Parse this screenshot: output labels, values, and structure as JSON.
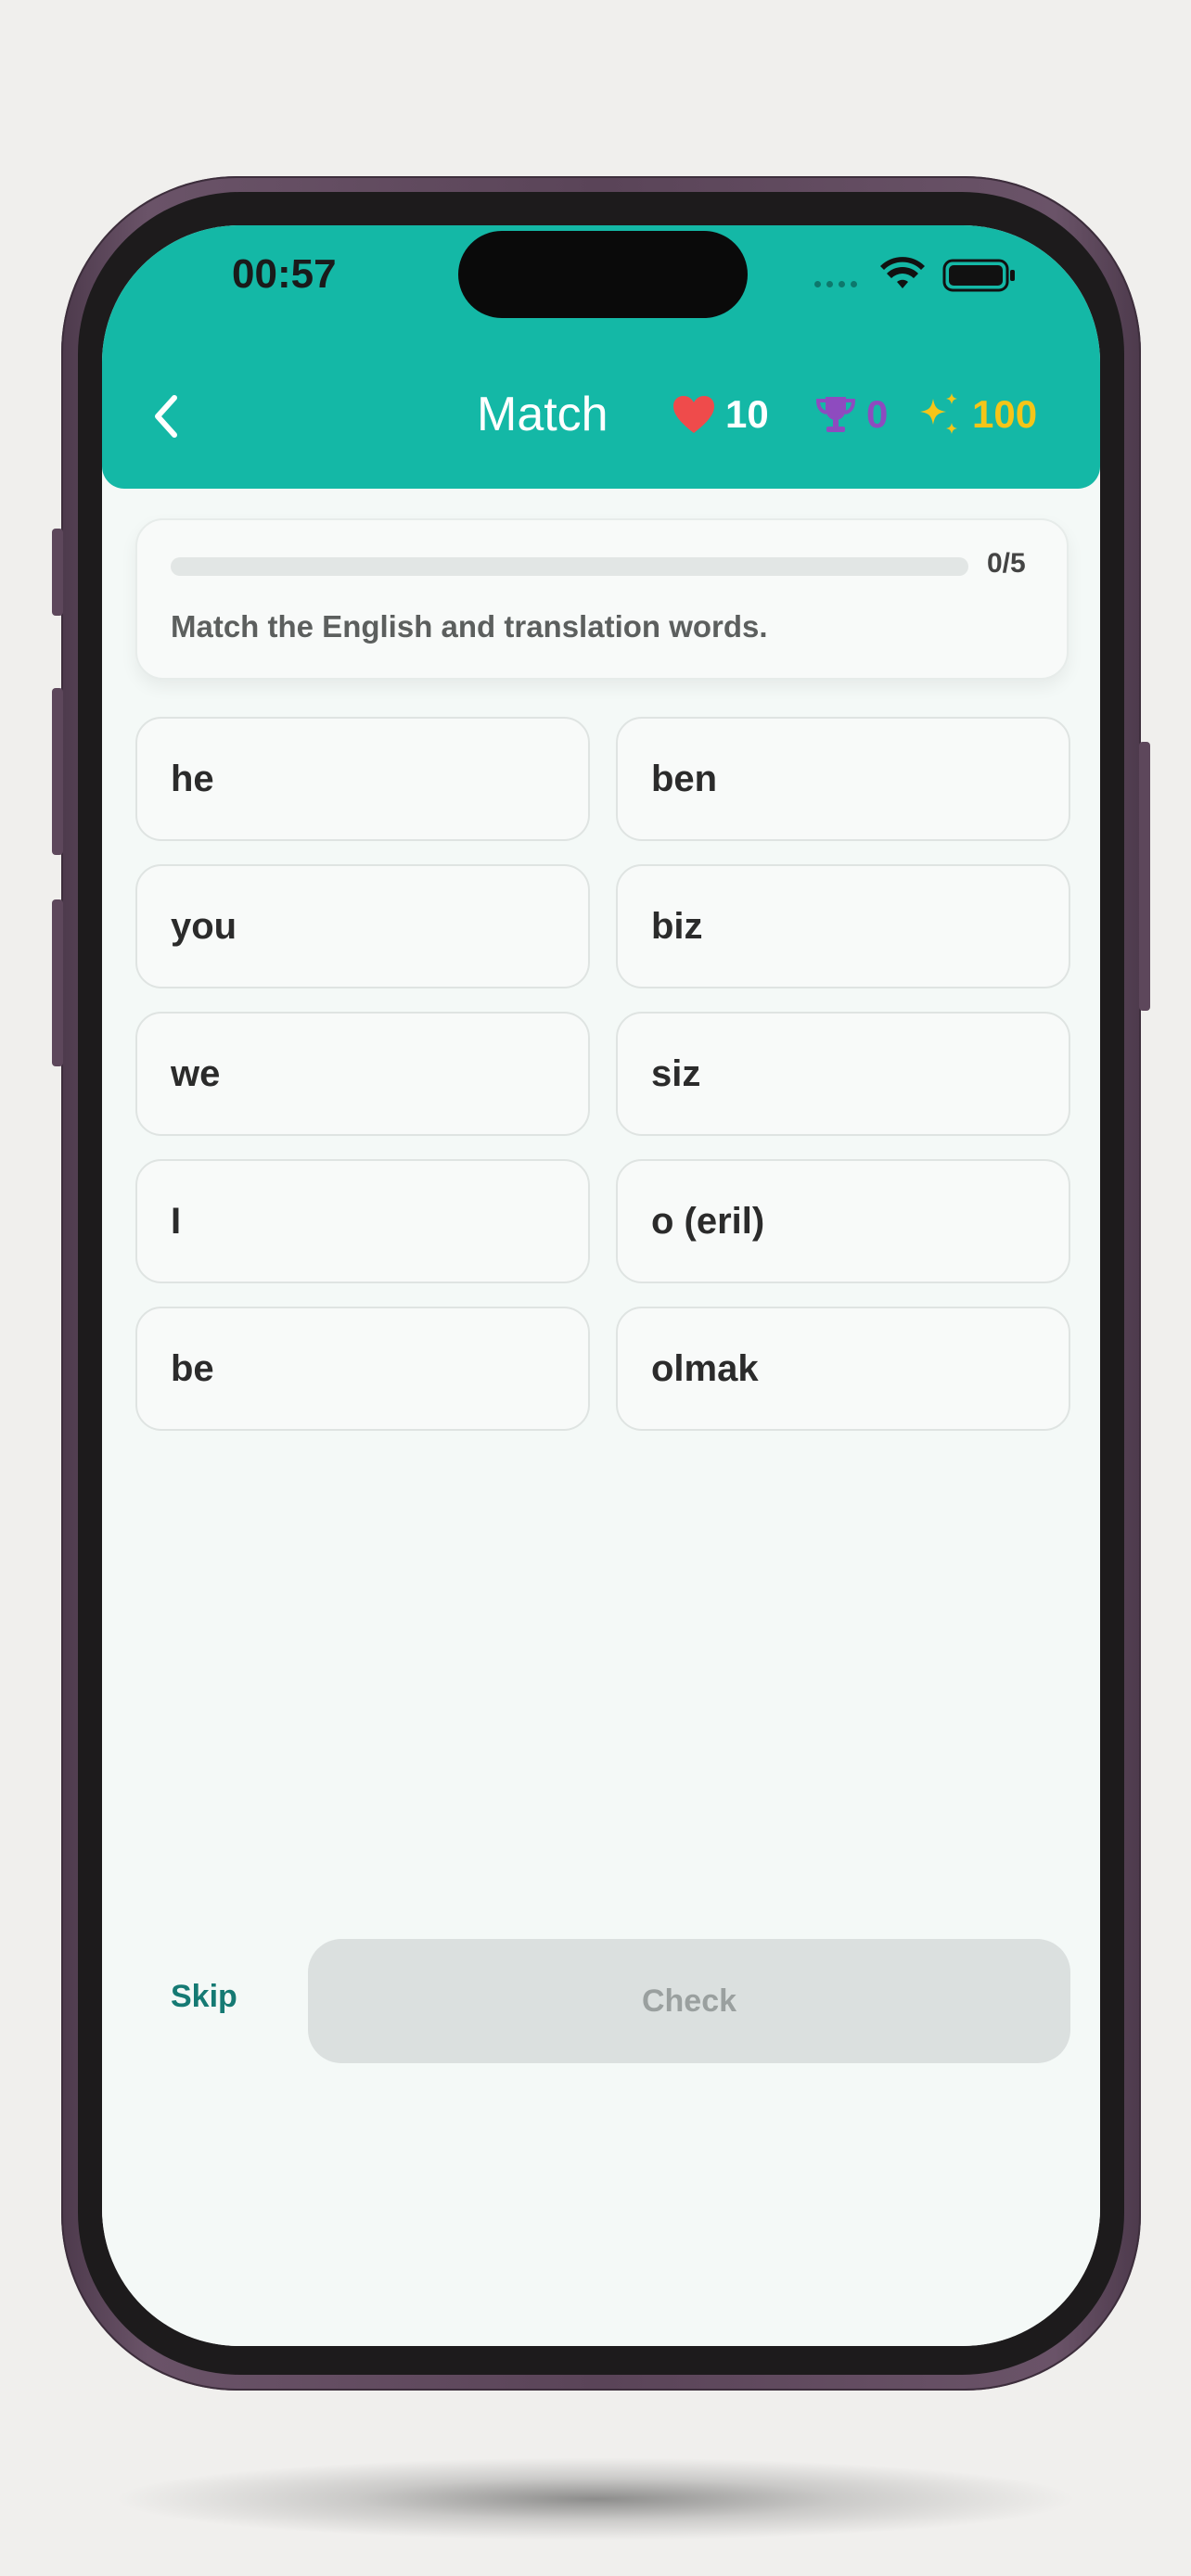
{
  "status_bar": {
    "time": "00:57",
    "wifi_icon": "wifi-icon",
    "battery_icon": "battery-icon"
  },
  "header": {
    "back_icon": "chevron-left-icon",
    "title": "Match",
    "hearts": {
      "icon": "heart-icon",
      "value": "10",
      "color": "#ef4b4b"
    },
    "trophies": {
      "icon": "trophy-icon",
      "value": "0",
      "color": "#8e4bbf"
    },
    "sparkles": {
      "icon": "sparkle-icon",
      "value": "100",
      "color": "#f5c518"
    },
    "background_color": "#14b8a6"
  },
  "progress": {
    "completed": 0,
    "total": 5,
    "label": "0/5",
    "instruction": "Match the English and translation words."
  },
  "pairs": {
    "english": [
      "he",
      "you",
      "we",
      "I",
      "be"
    ],
    "translation": [
      "ben",
      "biz",
      "siz",
      "o (eril)",
      "olmak"
    ]
  },
  "footer": {
    "skip_label": "Skip",
    "check_label": "Check"
  }
}
